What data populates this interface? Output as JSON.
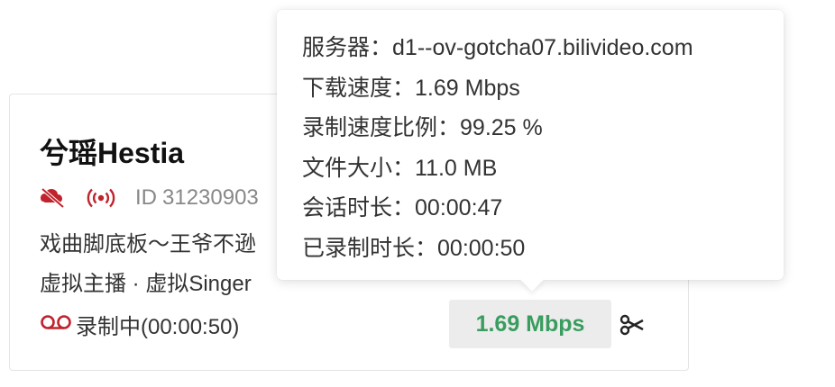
{
  "card": {
    "title": "兮瑶Hestia",
    "icons": {
      "danmaku_icon": "danmaku-off-icon",
      "broadcast_icon": "live-broadcast-icon",
      "danmaku_color": "#c0232c",
      "broadcast_color": "#c0232c"
    },
    "room_id_label": "ID",
    "room_id": "31230903",
    "room_name": "戏曲脚底板～王爷不逊",
    "tags": "虚拟主播 · 虚拟Singer",
    "status": "录制中(00:00:50)",
    "status_icon": "recording-icon",
    "status_color": "#c0232c",
    "speed": "1.69 Mbps",
    "speed_color": "#3a9d5f",
    "cut_icon": "scissors-icon"
  },
  "tooltip": {
    "lines": [
      {
        "label": "服务器：",
        "value": "d1--ov-gotcha07.bilivideo.com"
      },
      {
        "label": "下载速度：",
        "value": "1.69 Mbps"
      },
      {
        "label": "录制速度比例：",
        "value": "99.25 %"
      },
      {
        "label": "文件大小：",
        "value": "11.0 MB"
      },
      {
        "label": "会话时长：",
        "value": "00:00:47"
      },
      {
        "label": "已录制时长：",
        "value": "00:00:50"
      }
    ]
  }
}
